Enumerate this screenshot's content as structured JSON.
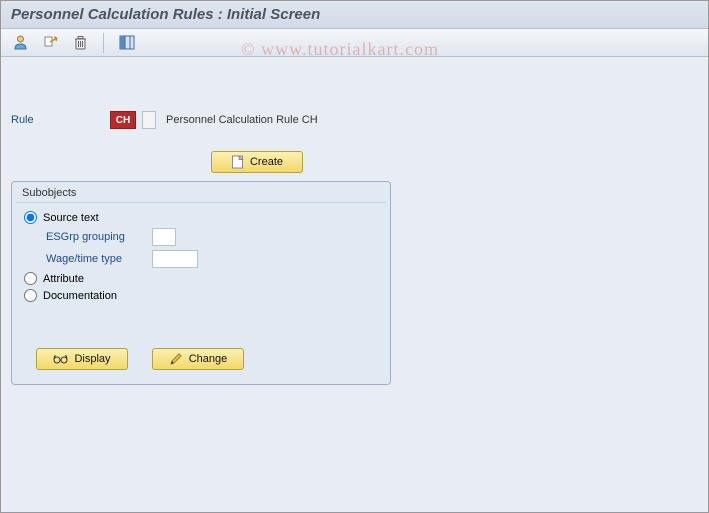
{
  "title": "Personnel Calculation Rules : Initial Screen",
  "watermark": "© www.tutorialkart.com",
  "toolbar": {
    "icons": [
      "person-icon",
      "copy-assign-icon",
      "delete-icon",
      "layout-icon"
    ]
  },
  "fields": {
    "rule_label": "Rule",
    "rule_value": "CH",
    "rule_desc": "Personnel Calculation Rule  CH"
  },
  "buttons": {
    "create": "Create",
    "display": "Display",
    "change": "Change"
  },
  "panel": {
    "title": "Subobjects",
    "options": {
      "source_text": "Source text",
      "attribute": "Attribute",
      "documentation": "Documentation"
    },
    "sub": {
      "esgrp_label": "ESGrp grouping",
      "esgrp_value": "",
      "wage_label": "Wage/time type",
      "wage_value": ""
    },
    "selected": "source_text"
  }
}
